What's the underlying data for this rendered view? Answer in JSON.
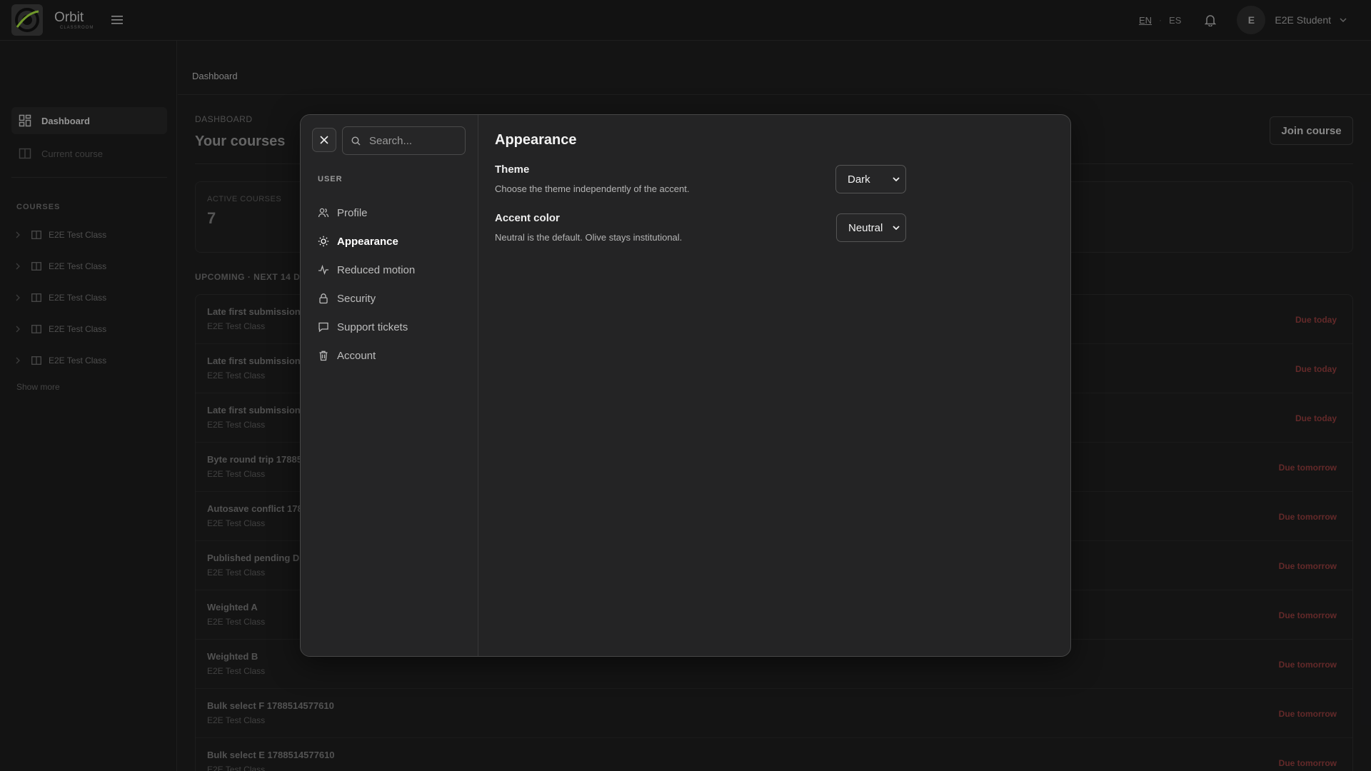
{
  "brand": {
    "name": "Orbit",
    "subtitle": "CLASSROOM"
  },
  "header": {
    "languages": [
      "EN",
      "ES"
    ],
    "separator": "·",
    "user_initial": "E",
    "user_name": "E2E Student"
  },
  "sidebar": {
    "items": [
      {
        "label": "Dashboard",
        "icon": "grid-icon"
      },
      {
        "label": "Current course",
        "icon": "book-icon"
      }
    ],
    "courses_heading": "COURSES",
    "courses": [
      "E2E Test Class",
      "E2E Test Class",
      "E2E Test Class",
      "E2E Test Class",
      "E2E Test Class"
    ],
    "show_more": "Show more"
  },
  "main": {
    "breadcrumb": "Dashboard",
    "section_label": "DASHBOARD",
    "title": "Your courses",
    "join_button": "Join course",
    "stat": {
      "label": "ACTIVE COURSES",
      "value": "7"
    },
    "upcoming_label": "UPCOMING · NEXT 14 DA",
    "tasks": [
      {
        "title": "Late first submission",
        "course": "E2E Test Class",
        "due": "Due today"
      },
      {
        "title": "Late first submission",
        "course": "E2E Test Class",
        "due": "Due today"
      },
      {
        "title": "Late first submission",
        "course": "E2E Test Class",
        "due": "Due today"
      },
      {
        "title": "Byte round trip 17885",
        "course": "E2E Test Class",
        "due": "Due tomorrow"
      },
      {
        "title": "Autosave conflict 178",
        "course": "E2E Test Class",
        "due": "Due tomorrow"
      },
      {
        "title": "Published pending D",
        "course": "E2E Test Class",
        "due": "Due tomorrow"
      },
      {
        "title": "Weighted A",
        "course": "E2E Test Class",
        "due": "Due tomorrow"
      },
      {
        "title": "Weighted B",
        "course": "E2E Test Class",
        "due": "Due tomorrow"
      },
      {
        "title": "Bulk select F 1788514577610",
        "course": "E2E Test Class",
        "due": "Due tomorrow"
      },
      {
        "title": "Bulk select E 1788514577610",
        "course": "E2E Test Class",
        "due": "Due tomorrow"
      }
    ]
  },
  "settings_modal": {
    "search_placeholder": "Search...",
    "nav_heading": "USER",
    "nav_items": [
      {
        "label": "Profile",
        "icon": "users-icon"
      },
      {
        "label": "Appearance",
        "icon": "sun-icon"
      },
      {
        "label": "Reduced motion",
        "icon": "activity-icon"
      },
      {
        "label": "Security",
        "icon": "lock-icon"
      },
      {
        "label": "Support tickets",
        "icon": "message-icon"
      },
      {
        "label": "Account",
        "icon": "trash-icon"
      }
    ],
    "active_item": "Appearance",
    "panel": {
      "title": "Appearance",
      "theme": {
        "label": "Theme",
        "description": "Choose the theme independently of the accent.",
        "value": "Dark"
      },
      "accent": {
        "label": "Accent color",
        "description": "Neutral is the default. Olive stays institutional.",
        "value": "Neutral"
      }
    }
  },
  "colors": {
    "background": "#1c1c1d",
    "modal": "#242425",
    "due": "#8a3a3a"
  }
}
